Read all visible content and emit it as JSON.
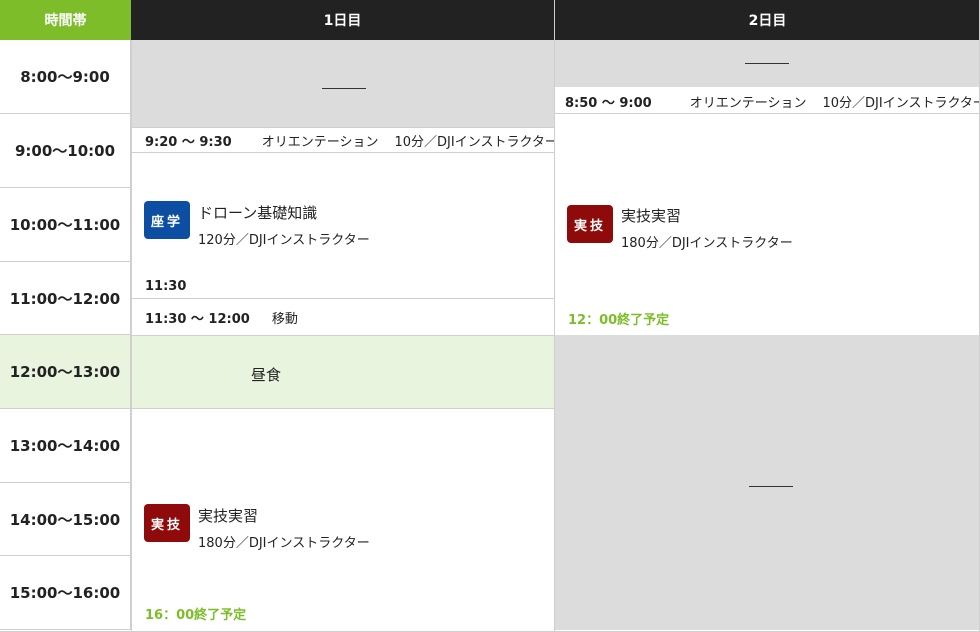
{
  "header": {
    "time_col": "時間帯",
    "day1": "1日目",
    "day2": "2日目"
  },
  "time_slots": [
    "8:00〜9:00",
    "9:00〜10:00",
    "10:00〜11:00",
    "11:00〜12:00",
    "12:00〜13:00",
    "13:00〜14:00",
    "14:00〜15:00",
    "15:00〜16:00"
  ],
  "day1": {
    "orientation": {
      "time": "9:20 〜 9:30",
      "title": "オリエンテーション",
      "detail": "10分／DJIインストラクター"
    },
    "lecture": {
      "badge": "座学",
      "title": "ドローン基礎知識",
      "detail": "120分／DJIインストラクター",
      "end_time": "11:30"
    },
    "move": {
      "time": "11:30 〜 12:00",
      "title": "移動"
    },
    "lunch": "昼食",
    "practice": {
      "badge": "実技",
      "title": "実技実習",
      "detail": "180分／DJIインストラクター",
      "end_note": "16：00終了予定"
    }
  },
  "day2": {
    "orientation": {
      "time": "8:50 〜 9:00",
      "title": "オリエンテーション",
      "detail": "10分／DJIインストラクター"
    },
    "practice": {
      "badge": "実技",
      "title": "実技実習",
      "detail": "180分／DJIインストラクター",
      "end_note": "12：00終了予定"
    }
  },
  "colors": {
    "accent_green": "#7dbd2a",
    "header_dark": "#222222",
    "lecture_blue": "#0b4ea2",
    "practice_red": "#8f0a0a",
    "lunch_bg": "#e9f4df",
    "empty_gray": "#dcdcdc"
  }
}
